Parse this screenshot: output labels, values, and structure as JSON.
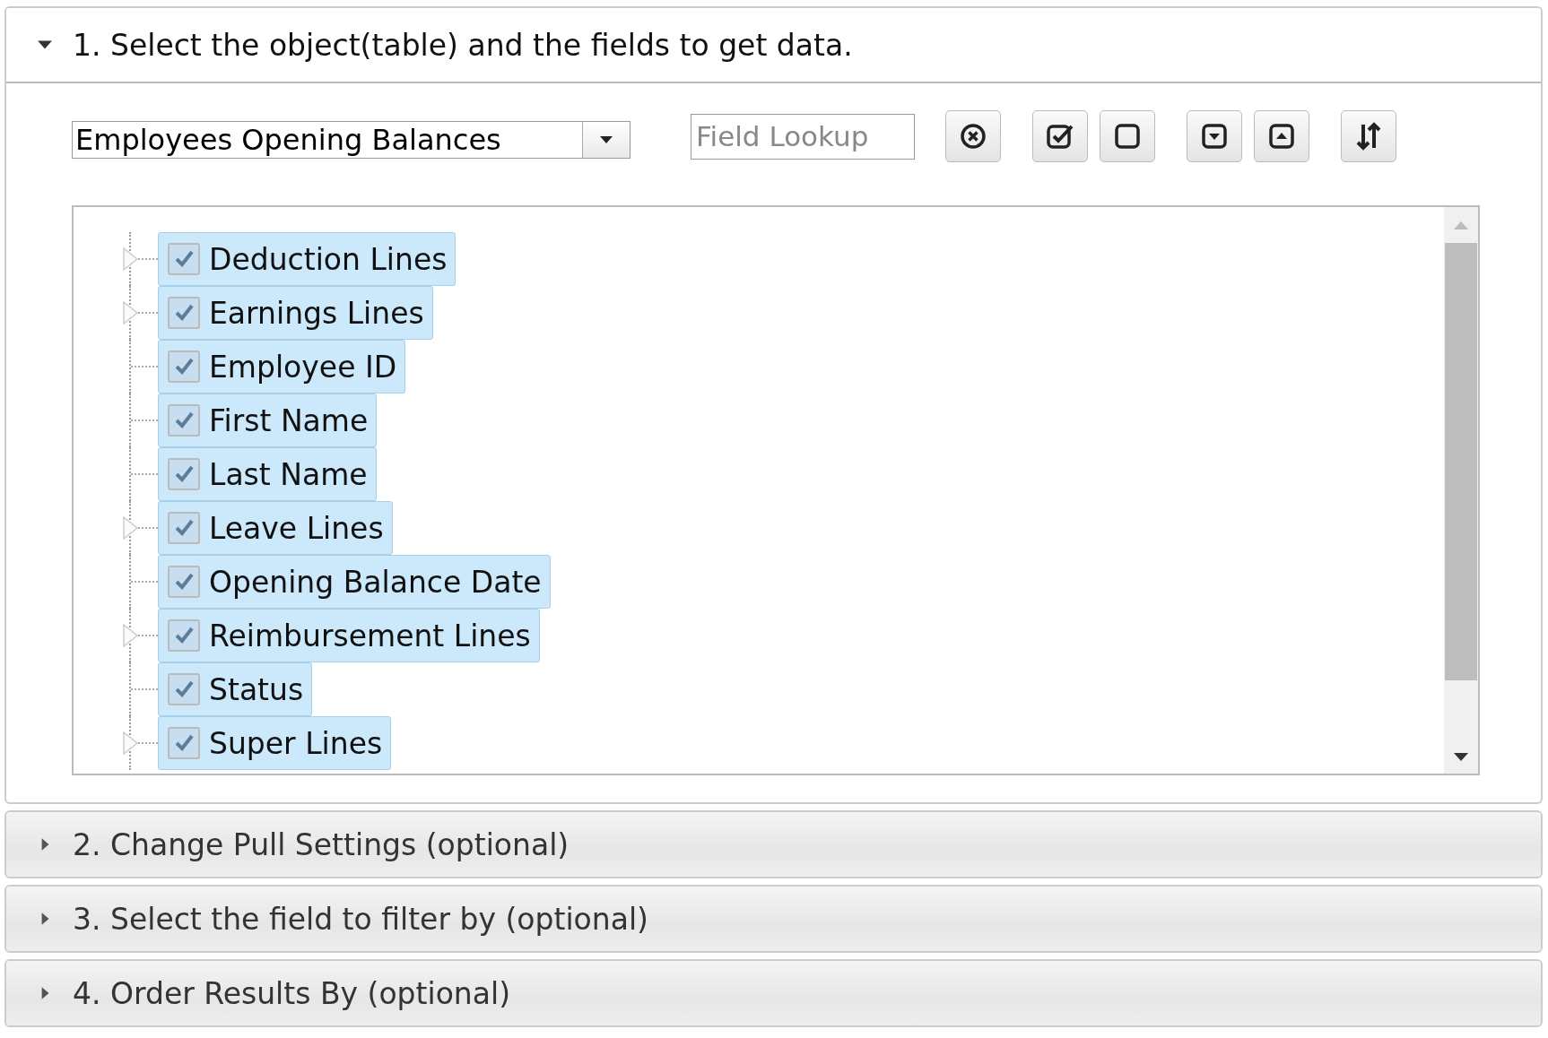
{
  "sections": [
    {
      "title": "1. Select the object(table) and the fields to get data.",
      "expanded": true
    },
    {
      "title": "2. Change Pull Settings (optional)",
      "expanded": false
    },
    {
      "title": "3. Select the field to filter by (optional)",
      "expanded": false
    },
    {
      "title": "4. Order Results By (optional)",
      "expanded": false
    }
  ],
  "object_select": {
    "value": "Employees Opening Balances"
  },
  "field_lookup": {
    "placeholder": "Field Lookup"
  },
  "fields": [
    {
      "label": "Deduction Lines",
      "kind": "branch",
      "checked": true,
      "selected": true
    },
    {
      "label": "Earnings Lines",
      "kind": "branch",
      "checked": true,
      "selected": true
    },
    {
      "label": "Employee ID",
      "kind": "leaf",
      "checked": true,
      "selected": true
    },
    {
      "label": "First Name",
      "kind": "leaf",
      "checked": true,
      "selected": true
    },
    {
      "label": "Last Name",
      "kind": "leaf",
      "checked": true,
      "selected": true
    },
    {
      "label": "Leave Lines",
      "kind": "branch",
      "checked": true,
      "selected": true
    },
    {
      "label": "Opening Balance Date",
      "kind": "leaf",
      "checked": true,
      "selected": true
    },
    {
      "label": "Reimbursement Lines",
      "kind": "branch",
      "checked": true,
      "selected": true
    },
    {
      "label": "Status",
      "kind": "leaf",
      "checked": true,
      "selected": true
    },
    {
      "label": "Super Lines",
      "kind": "branch",
      "checked": true,
      "selected": true
    }
  ]
}
